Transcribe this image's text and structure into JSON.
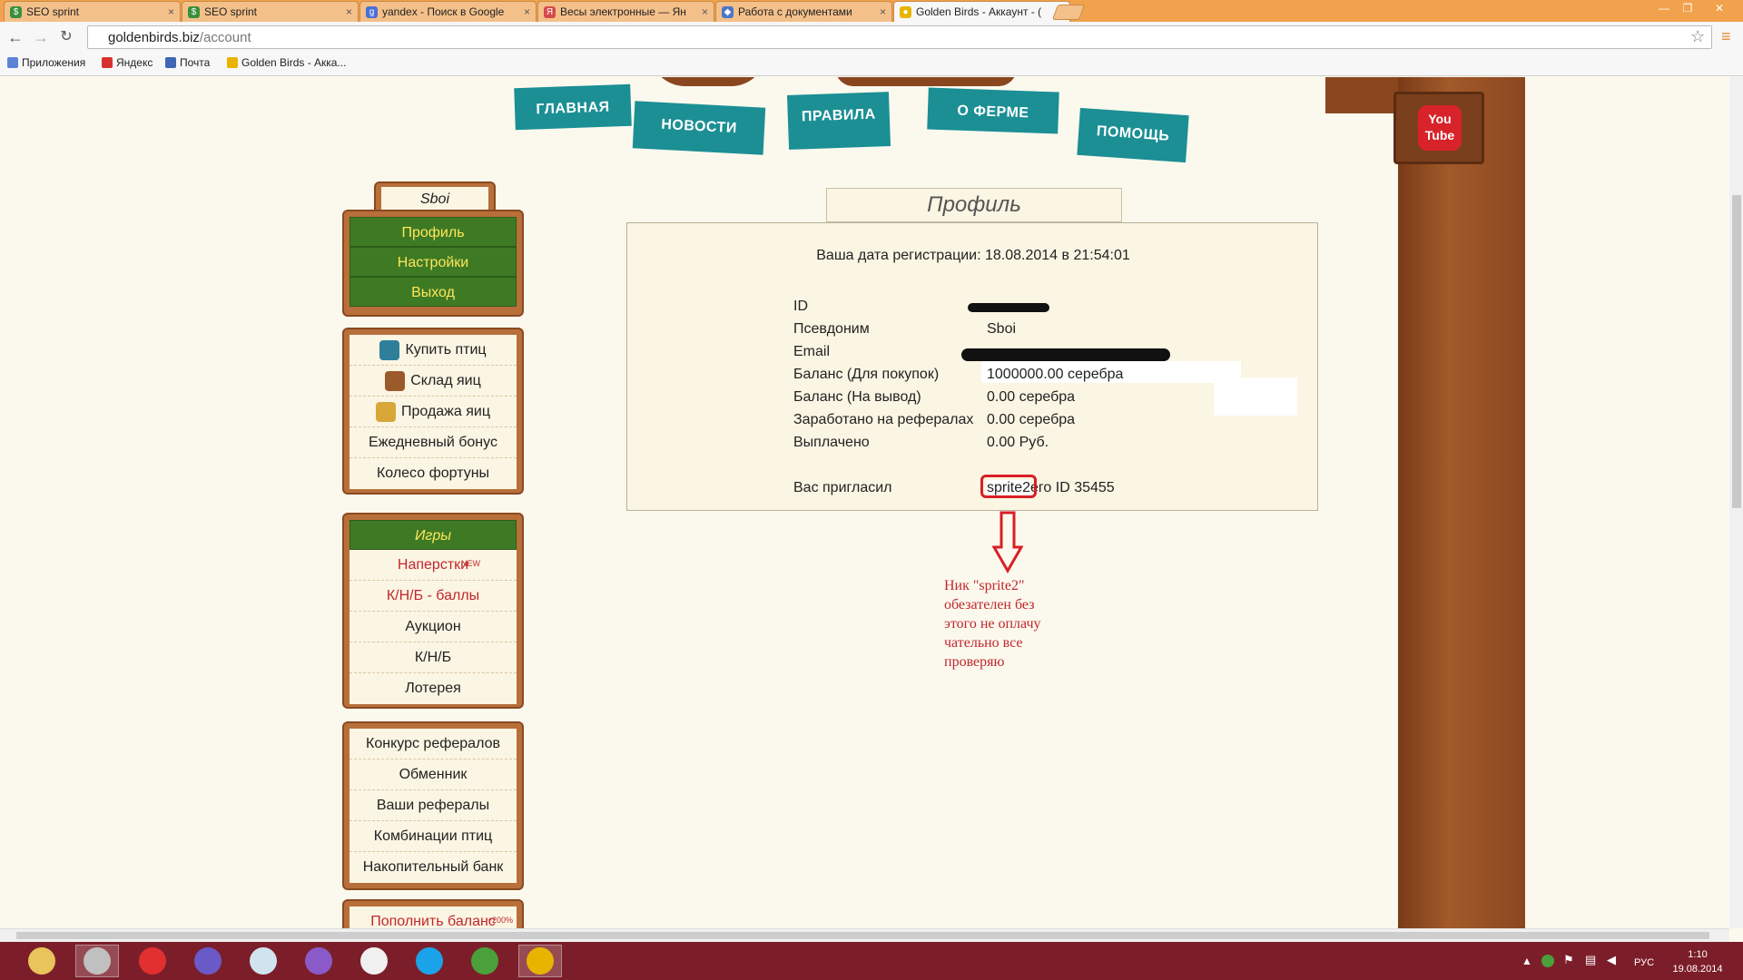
{
  "browser": {
    "tabs": [
      {
        "label": "SEO sprint",
        "icon_color": "#3a8f3a",
        "icon_glyph": "$"
      },
      {
        "label": "SEO sprint",
        "icon_color": "#3a8f3a",
        "icon_glyph": "$"
      },
      {
        "label": "yandex - Поиск в Google",
        "icon_color": "#4a6fd6",
        "icon_glyph": "g"
      },
      {
        "label": "Весы электронные — Ян",
        "icon_color": "#d64a4a",
        "icon_glyph": "Я"
      },
      {
        "label": "Работа с документами",
        "icon_color": "#4a78c8",
        "icon_glyph": "◆"
      },
      {
        "label": "Golden Birds - Аккаунт - (",
        "icon_color": "#e8b400",
        "icon_glyph": "●"
      }
    ],
    "url_host": "goldenbirds.biz",
    "url_path": "/account",
    "bookmarks": [
      {
        "label": "Приложения",
        "icon_color": "#5b83d6"
      },
      {
        "label": "Яндекс",
        "icon_color": "#d6332f"
      },
      {
        "label": "Почта",
        "icon_color": "#3e68b6"
      },
      {
        "label": "Golden Birds - Акка...",
        "icon_color": "#e8b400"
      }
    ]
  },
  "site_nav": [
    "ГЛАВНАЯ",
    "НОВОСТИ",
    "ПРАВИЛА",
    "О ФЕРМЕ",
    "ПОМОЩЬ"
  ],
  "youtube": {
    "line1": "You",
    "line2": "Tube"
  },
  "user_panel": {
    "username": "Sboi",
    "items": [
      "Профиль",
      "Настройки",
      "Выход"
    ]
  },
  "shop_panel": {
    "items": [
      {
        "label": "Купить птиц",
        "icon": "cart-icon",
        "icon_color": "#2f7f9a"
      },
      {
        "label": "Склад яиц",
        "icon": "box-icon",
        "icon_color": "#9b5a2a"
      },
      {
        "label": "Продажа яиц",
        "icon": "coins-icon",
        "icon_color": "#d9a63a"
      },
      {
        "label": "Ежедневный бонус"
      },
      {
        "label": "Колесо фортуны"
      }
    ]
  },
  "games_panel": {
    "header": "Игры",
    "items": [
      {
        "label": "Наперстки",
        "badge": "NEW",
        "red": true
      },
      {
        "label": "К/Н/Б - баллы",
        "red": true
      },
      {
        "label": "Аукцион"
      },
      {
        "label": "К/Н/Б"
      },
      {
        "label": "Лотерея"
      }
    ]
  },
  "referral_panel": {
    "items": [
      "Конкурс рефералов",
      "Обменник",
      "Ваши рефералы",
      "Комбинации птиц",
      "Накопительный банк"
    ]
  },
  "topup": {
    "label": "Пополнить баланс",
    "badge": "+200%"
  },
  "profile": {
    "title": "Профиль",
    "registration": "Ваша дата регистрации: 18.08.2014 в 21:54:01",
    "rows": [
      {
        "label": "ID",
        "value": ""
      },
      {
        "label": "Псевдоним",
        "value": "Sboi"
      },
      {
        "label": "Email",
        "value": ""
      },
      {
        "label": "Баланс (Для покупок)",
        "value": "1000000.00 серебра"
      },
      {
        "label": "Баланс (На вывод)",
        "value": "0.00 серебра"
      },
      {
        "label": "Заработано на рефералах",
        "value": "0.00 серебра"
      },
      {
        "label": "Выплачено",
        "value": "0.00 Руб."
      }
    ],
    "invited_label": "Вас пригласил",
    "invited_nick": "sprite2",
    "invited_suffix": "его ID 35455"
  },
  "annotation": {
    "lines": [
      "Ник \"sprite2\"",
      "обезателен без",
      "этого не оплачу",
      "чательно все",
      "проверяю"
    ]
  },
  "taskbar": {
    "apps": [
      {
        "name": "file-explorer-icon",
        "color": "#e8c45a",
        "active": false
      },
      {
        "name": "opera-icon",
        "color": "#c0c0c0",
        "active": true
      },
      {
        "name": "gift-icon",
        "color": "#e03030",
        "active": false
      },
      {
        "name": "eclipse-icon",
        "color": "#6a5ac8",
        "active": false
      },
      {
        "name": "cube-icon",
        "color": "#d0e4f0",
        "active": false
      },
      {
        "name": "visual-studio-icon",
        "color": "#8a5ac8",
        "active": false
      },
      {
        "name": "alien-icon",
        "color": "#f0f0f0",
        "active": false
      },
      {
        "name": "skype-icon",
        "color": "#1aa3e8",
        "active": false
      },
      {
        "name": "utorrent-icon",
        "color": "#4aa03a",
        "active": false
      },
      {
        "name": "chrome-icon",
        "color": "#e8b400",
        "active": true
      }
    ],
    "lang": "РУС",
    "time": "1:10",
    "date": "19.08.2014"
  }
}
